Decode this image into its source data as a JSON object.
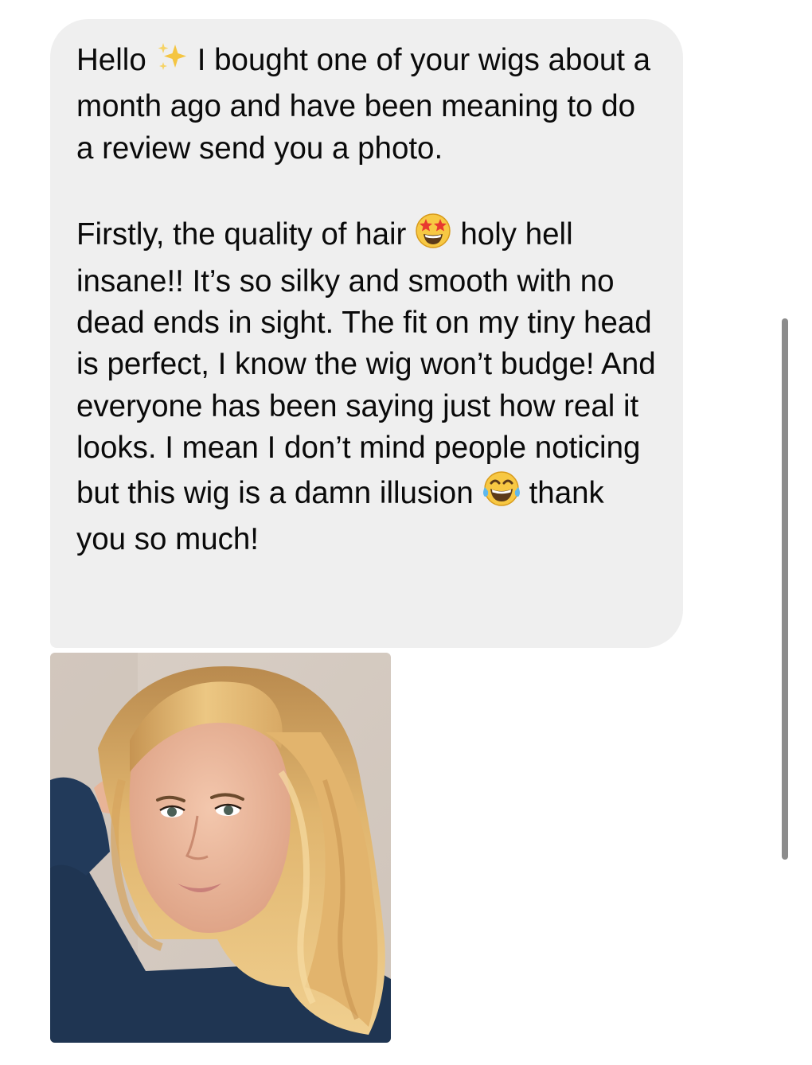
{
  "message": {
    "paragraph1": {
      "greeting": "Hello",
      "emoji1": "sparkles-emoji",
      "text": "I bought one of your wigs about a month ago and have been meaning to do a review send you a photo."
    },
    "paragraph2": {
      "part1": "Firstly, the quality of hair",
      "emoji2": "star-struck-emoji",
      "part2": "holy hell insane!! It’s so silky and smooth with no dead ends in sight. The fit on my tiny head is perfect, I know the wig won’t budge! And everyone has been saying just how real it looks. I mean I don’t mind people noticing but this wig is a damn illusion",
      "emoji3": "tears-of-joy-emoji",
      "part3": "thank you so much!"
    }
  },
  "attachment": {
    "type": "photo",
    "subject": "selfie-blonde-wavy-wig"
  },
  "colors": {
    "bubble_bg": "#efefef",
    "text": "#0a0a0a",
    "background": "#ffffff",
    "scrollbar": "#8c8c8c"
  }
}
